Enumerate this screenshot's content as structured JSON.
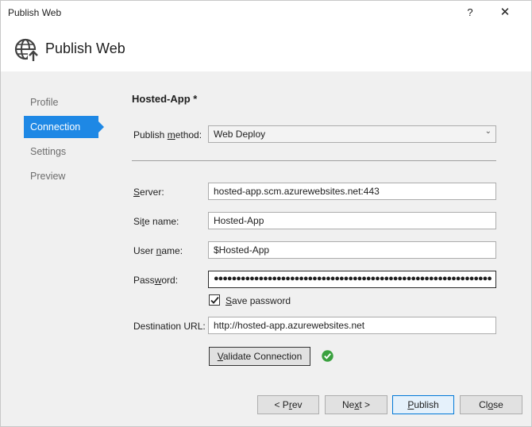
{
  "window": {
    "title": "Publish Web",
    "help_glyph": "?",
    "close_glyph": "✕"
  },
  "header": {
    "title": "Publish Web",
    "icon": "globe-publish-icon"
  },
  "nav": {
    "items": [
      {
        "label": "Profile",
        "active": false
      },
      {
        "label": "Connection",
        "active": true
      },
      {
        "label": "Settings",
        "active": false
      },
      {
        "label": "Preview",
        "active": false
      }
    ]
  },
  "profile": {
    "name": "Hosted-App *"
  },
  "form": {
    "publish_method": {
      "label_pre": "Publish ",
      "label_key": "m",
      "label_post": "ethod:",
      "value": "Web Deploy"
    },
    "server": {
      "label_key": "S",
      "label_post": "erver:",
      "value": "hosted-app.scm.azurewebsites.net:443"
    },
    "site_name": {
      "label_pre": "Si",
      "label_key": "t",
      "label_post": "e name:",
      "value": "Hosted-App"
    },
    "user_name": {
      "label_pre": "User ",
      "label_key": "n",
      "label_post": "ame:",
      "value": "$Hosted-App"
    },
    "password": {
      "label_pre": "Pass",
      "label_key": "w",
      "label_post": "ord:",
      "value": "●●●●●●●●●●●●●●●●●●●●●●●●●●●●●●●●●●●●●●●●●●●●●●●●●●●●●●●●●●●●●●"
    },
    "save_password": {
      "label_key": "S",
      "label_post": "ave password",
      "checked": true
    },
    "destination_url": {
      "label": "Destination URL:",
      "value": "http://hosted-app.azurewebsites.net"
    },
    "validate": {
      "label_key": "V",
      "label_post": "alidate Connection",
      "status_icon": "check-circle-icon"
    }
  },
  "footer": {
    "prev": {
      "label_pre": "< P",
      "label_key": "r",
      "label_post": "ev"
    },
    "next": {
      "label_pre": "Ne",
      "label_key": "x",
      "label_post": "t >"
    },
    "publish": {
      "label_key": "P",
      "label_post": "ublish"
    },
    "close": {
      "label_pre": "Cl",
      "label_key": "o",
      "label_post": "se"
    }
  },
  "colors": {
    "accent": "#1e88e5",
    "success": "#3aa13f"
  }
}
